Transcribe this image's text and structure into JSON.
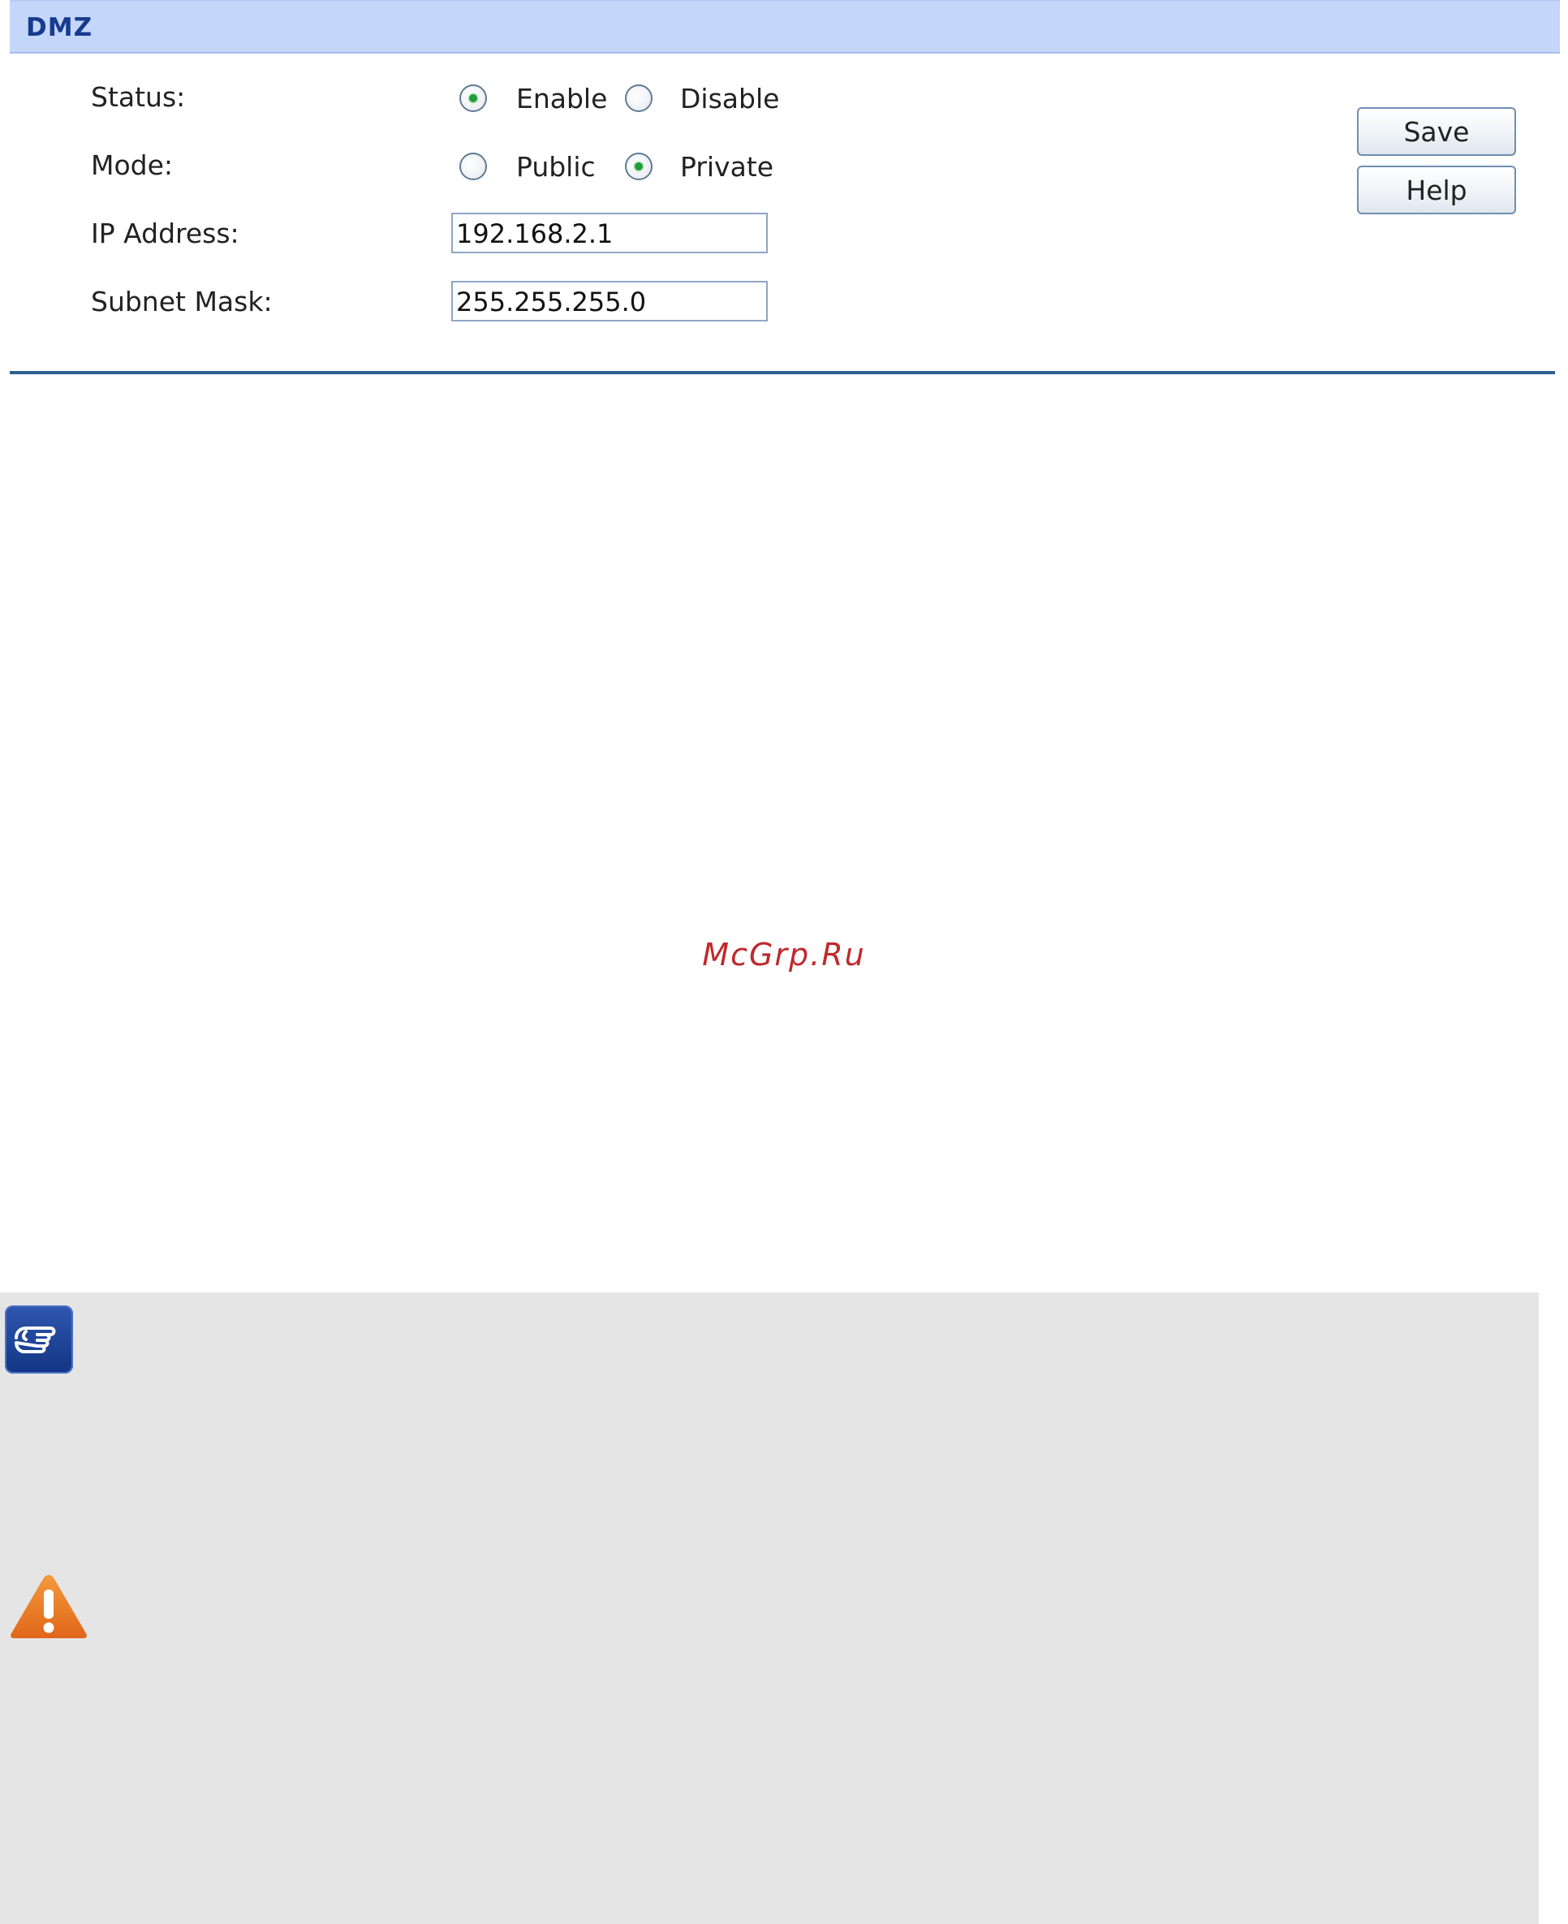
{
  "header": {
    "title": "DMZ"
  },
  "form": {
    "status": {
      "label": "Status:",
      "options": [
        "Enable",
        "Disable"
      ],
      "selected": "Enable"
    },
    "mode": {
      "label": "Mode:",
      "options": [
        "Public",
        "Private"
      ],
      "selected": "Private"
    },
    "ip_address": {
      "label": "IP Address:",
      "value": "192.168.2.1"
    },
    "subnet_mask": {
      "label": "Subnet Mask:",
      "value": "255.255.255.0"
    }
  },
  "buttons": {
    "save": "Save",
    "help": "Help"
  },
  "watermark": "McGrp.Ru",
  "icons": {
    "note": "pointing-hand-icon",
    "warning": "warning-icon"
  },
  "colors": {
    "header_bg": "#c5d6fb",
    "header_text": "#173c8d",
    "divider": "#2d5f8f",
    "radio_dot": "#1f9d3a",
    "watermark": "#c0282c",
    "notes_bg": "#e5e5e5",
    "warning": "#e8781f"
  }
}
